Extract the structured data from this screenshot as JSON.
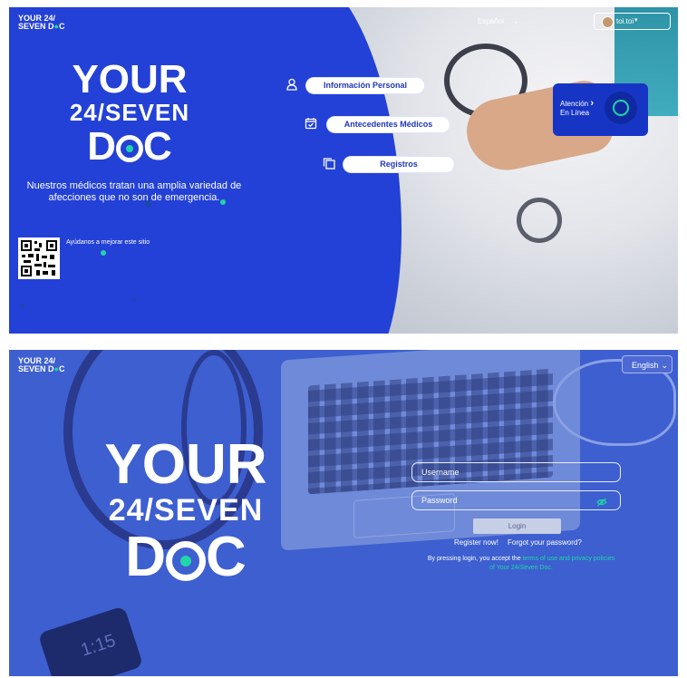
{
  "top": {
    "logo_small": {
      "line1": "YOUR 24/",
      "line2": "SEVEN D",
      "line2_end": "C"
    },
    "logo_big": {
      "line1": "YOUR",
      "line2": "24/SEVEN",
      "line3a": "D",
      "line3b": "C"
    },
    "language": "Español",
    "user": {
      "name": "toi.toi"
    },
    "description": "Nuestros médicos tratan una amplia variedad de afecciones que no son de emergencia.",
    "qr_caption": "Ayúdanos a mejorar este sitio",
    "menu": [
      {
        "label": "Información Personal",
        "icon": "person-icon"
      },
      {
        "label": "Antecedentes Médicos",
        "icon": "calendar-check-icon"
      },
      {
        "label": "Registros",
        "icon": "copy-icon"
      }
    ],
    "online_card": {
      "line1": "Atención",
      "line2": "En Línea",
      "arrow": "›"
    },
    "colors": {
      "primary": "#2341d6",
      "accent": "#20d6a6"
    }
  },
  "bottom": {
    "logo_small": {
      "line1": "YOUR 24/",
      "line2": "SEVEN D",
      "line2_end": "C"
    },
    "logo_big": {
      "line1": "YOUR",
      "line2": "24/SEVEN",
      "line3a": "D",
      "line3b": "C"
    },
    "language": "English",
    "phone_time": "1:15",
    "username_placeholder": "Username",
    "password_placeholder": "Password",
    "login_label": "Login",
    "register_label": "Register now!",
    "forgot_label": "Forgot your password?",
    "terms_prefix": "By pressing login, you accept the ",
    "terms_link": "terms of use and privacy policies of Your 24/Seven Doc.",
    "colors": {
      "overlay": "#3d5fd0",
      "accent": "#20d6a6"
    }
  }
}
